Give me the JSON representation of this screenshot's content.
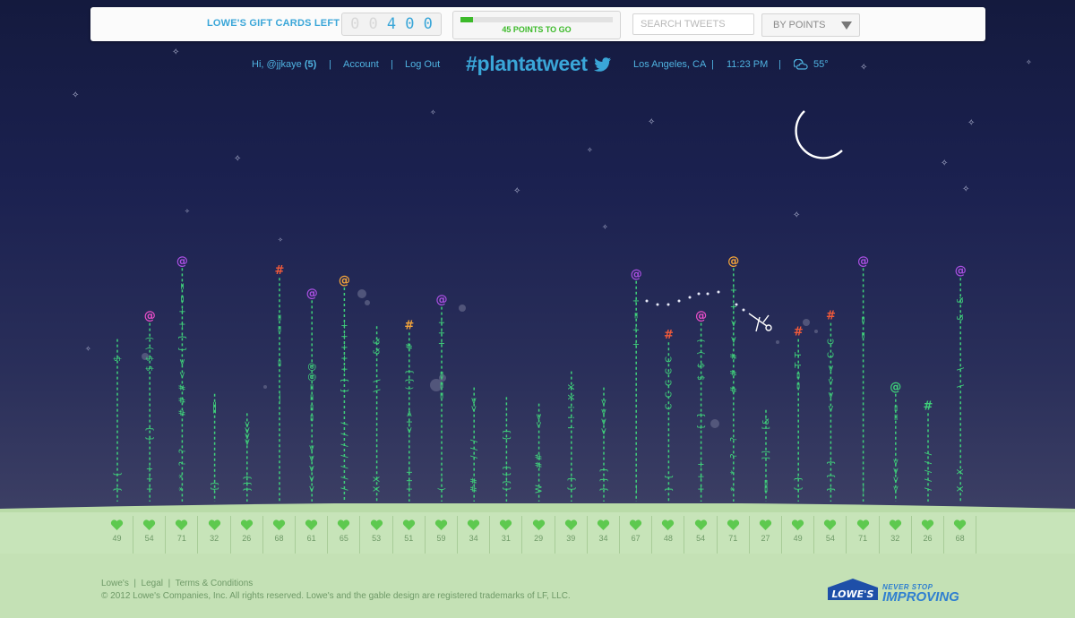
{
  "header": {
    "gift_cards_label": "LOWE'S GIFT CARDS LEFT",
    "gift_card_digits": [
      "0",
      "0",
      "4",
      "0",
      "0"
    ],
    "points_to_go": "45 POINTS TO GO",
    "points_progress": 0.08,
    "search_placeholder": "SEARCH TWEETS",
    "sort_value": "BY POINTS"
  },
  "nav": {
    "greeting": "Hi, @jjkaye",
    "greeting_count": "(5)",
    "account": "Account",
    "logout": "Log Out",
    "brand": "#plantatweet",
    "location": "Los Angeles, CA",
    "time": "11:23 PM",
    "temperature": "55°",
    "weather_icon": "moon-cloud-icon"
  },
  "colors": {
    "accent_blue": "#3aa6d8",
    "stem_green": "#3fd07a",
    "ground_green": "#c8e3b8",
    "heart_green": "#5ec94f",
    "pink": "#e64ec7",
    "purple": "#a84fe0",
    "orange": "#f2a43a",
    "red": "#f05a3a"
  },
  "plants": [
    {
      "score": "49",
      "flower": "",
      "flower_color": "green",
      "chars": "}{|||||||$"
    },
    {
      "score": "54",
      "flower": "@",
      "flower_color": "pink",
      "chars": "+++||{}|||||$$))"
    },
    {
      "score": "71",
      "flower": "@",
      "flower_color": "purple",
      "chars": "**??||###<<{}++=="
    },
    {
      "score": "32",
      "flower": "",
      "flower_color": "green",
      "chars": "{}||||||||||||=="
    },
    {
      "score": "26",
      "flower": "",
      "flower_color": "green",
      "chars": "}}}|||||<<<<"
    },
    {
      "score": "68",
      "flower": "#",
      "flower_color": "red",
      "chars": "||||||||—||=||==||"
    },
    {
      "score": "61",
      "flower": "@",
      "flower_color": "purple",
      "chars": "<<<<<||====@@|||||"
    },
    {
      "score": "65",
      "flower": "@",
      "flower_color": "orange",
      "chars": "///////||{}+++++||"
    },
    {
      "score": "53",
      "flower": "",
      "flower_color": "green",
      "chars": "XX||||||||\\\\||&&"
    },
    {
      "score": "51",
      "flower": "#",
      "flower_color": "orange",
      "chars": "+++||||<+>||(}}||#"
    },
    {
      "score": "59",
      "flower": "@",
      "flower_color": "purple",
      "chars": "(-|||||||===||+++"
    },
    {
      "score": "34",
      "flower": "",
      "flower_color": "green",
      "chars": "##||///|||<<"
    },
    {
      "score": "31",
      "flower": "",
      "flower_color": "green",
      "chars": "{}{}|||{}|||"
    },
    {
      "score": "29",
      "flower": "",
      "flower_color": "green",
      "chars": "W||##|||<<"
    },
    {
      "score": "39",
      "flower": "",
      "flower_color": "green",
      "chars": "{}||||!!!XX"
    },
    {
      "score": "34",
      "flower": "",
      "flower_color": "green",
      "chars": "}}}|||<<<<"
    },
    {
      "score": "67",
      "flower": "@",
      "flower_color": "purple",
      "chars": "—|||||||||++=+"
    },
    {
      "score": "48",
      "flower": "#",
      "flower_color": "red",
      "chars": "}{|||||CCCCC"
    },
    {
      "score": "54",
      "flower": "@",
      "flower_color": "pink",
      "chars": "+++||{}||$$))"
    },
    {
      "score": "71",
      "flower": "@",
      "flower_color": "orange",
      "chars": "**??||###<<++"
    },
    {
      "score": "27",
      "flower": "",
      "flower_color": "green",
      "chars": "==|||]]|||[&"
    },
    {
      "score": "49",
      "flower": "#",
      "flower_color": "red",
      "chars": "{}||||||||==TT"
    },
    {
      "score": "54",
      "flower": "#",
      "flower_color": "red",
      "chars": "}}}|||<<<<CC"
    },
    {
      "score": "71",
      "flower": "@",
      "flower_color": "purple",
      "chars": "—|||||||||==||"
    },
    {
      "score": "32",
      "flower": "@",
      "flower_color": "green",
      "chars": "<<<<||||=="
    },
    {
      "score": "26",
      "flower": "#",
      "flower_color": "green",
      "chars": "/////|||"
    },
    {
      "score": "68",
      "flower": "@",
      "flower_color": "purple",
      "chars": "XX||||\\\\||&&"
    }
  ],
  "footer": {
    "links": [
      "Lowe's",
      "Legal",
      "Terms & Conditions"
    ],
    "copyright": "© 2012 Lowe's Companies, Inc. All rights reserved. Lowe's and the gable design are registered trademarks of LF, LLC.",
    "logo_text": "LOWE'S",
    "tagline_1": "NEVER STOP",
    "tagline_2": "IMPROVING"
  }
}
